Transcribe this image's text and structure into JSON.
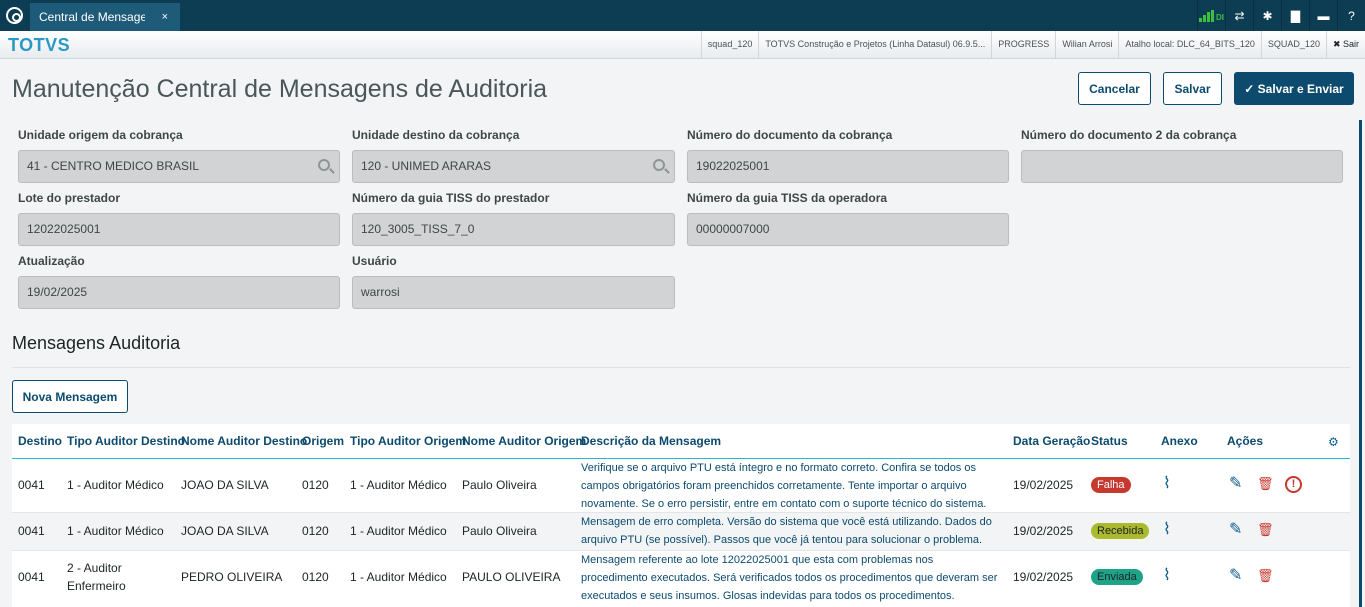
{
  "topbar": {
    "tab_label": "Central de Mensagens",
    "tab_close": "×",
    "icons": [
      "signal-icon",
      "shuffle-icon",
      "gear-icon",
      "document-icon",
      "chat-icon",
      "help-icon"
    ],
    "signal_text": "DI",
    "gear_glyph": "✱",
    "document_glyph": "▇",
    "chat_glyph": "▬",
    "help_glyph": "?",
    "shuffle_glyph": "⇄"
  },
  "brandbar": {
    "brand": "TOTVS",
    "infos": [
      "squad_120",
      "TOTVS Construção e Projetos (Linha Datasul) 06.9.5...",
      "PROGRESS",
      "Wilian Arrosi",
      "Atalho local: DLC_64_BITS_120",
      "SQUAD_120"
    ],
    "exit_label": "✖ Sair"
  },
  "page": {
    "title": "Manutenção Central de Mensagens de Auditoria",
    "cancel_label": "Cancelar",
    "save_label": "Salvar",
    "save_send_label": "✓ Salvar e Enviar"
  },
  "form": {
    "unidade_origem": {
      "label": "Unidade origem da cobrança",
      "value": "41 - CENTRO MEDICO BRASIL"
    },
    "unidade_destino": {
      "label": "Unidade destino da cobrança",
      "value": "120 - UNIMED ARARAS"
    },
    "numero_documento": {
      "label": "Número do documento da cobrança",
      "value": "19022025001"
    },
    "numero_documento2": {
      "label": "Número do documento 2 da cobrança",
      "value": ""
    },
    "lote_prestador": {
      "label": "Lote do prestador",
      "value": "12022025001"
    },
    "guia_prestador": {
      "label": "Número da guia TISS do prestador",
      "value": "120_3005_TISS_7_0"
    },
    "guia_operadora": {
      "label": "Número da guia TISS da operadora",
      "value": "00000007000"
    },
    "atualizacao": {
      "label": "Atualização",
      "value": "19/02/2025"
    },
    "usuario": {
      "label": "Usuário",
      "value": "warrosi"
    }
  },
  "messages": {
    "section_title": "Mensagens Auditoria",
    "new_button": "Nova Mensagem",
    "columns": [
      "Destino",
      "Tipo Auditor Destino",
      "Nome Auditor Destino",
      "Origem",
      "Tipo Auditor Origem",
      "Nome Auditor Origem",
      "Descrição da Mensagem",
      "Data Geração",
      "Status",
      "Anexo",
      "Ações"
    ],
    "rows": [
      {
        "destino": "0041",
        "tipo_destino": "1 - Auditor Médico",
        "nome_destino": "JOAO DA SILVA",
        "origem": "0120",
        "tipo_origem": "1 - Auditor Médico",
        "nome_origem": "Paulo Oliveira",
        "descricao": "Verifique se o arquivo PTU está íntegro e no formato correto. Confira se todos os campos obrigatórios foram preenchidos corretamente. Tente importar o arquivo novamente. Se o erro persistir, entre em contato com o suporte técnico do sistema.",
        "data": "19/02/2025",
        "status": "Falha"
      },
      {
        "destino": "0041",
        "tipo_destino": "1 - Auditor Médico",
        "nome_destino": "JOAO DA SILVA",
        "origem": "0120",
        "tipo_origem": "1 - Auditor Médico",
        "nome_origem": "Paulo Oliveira",
        "descricao": "Mensagem de erro completa. Versão do sistema que você está utilizando. Dados do arquivo PTU (se possível). Passos que você já tentou para solucionar o problema.",
        "data": "19/02/2025",
        "status": "Recebida"
      },
      {
        "destino": "0041",
        "tipo_destino": "2 - Auditor Enfermeiro",
        "nome_destino": "PEDRO OLIVEIRA",
        "origem": "0120",
        "tipo_origem": "1 - Auditor Médico",
        "nome_origem": "PAULO OLIVEIRA",
        "descricao": "Mensagem referente ao lote 12022025001 que esta com problemas nos procedimento executados. Será verificados todos os procedimentos que deveram ser executados e seus insumos. Glosas indevidas para todos os procedimentos.",
        "data": "19/02/2025",
        "status": "Enviada"
      }
    ],
    "icons": {
      "clip": "⌇",
      "pencil": "✎",
      "trash": "🗑",
      "alert": "!",
      "gear": "⚙"
    }
  },
  "colors": {
    "primary": "#0c4a6e",
    "brand": "#2c98c6",
    "falha": "#c6392f",
    "recebida": "#aab92e",
    "enviada": "#1ea388"
  }
}
